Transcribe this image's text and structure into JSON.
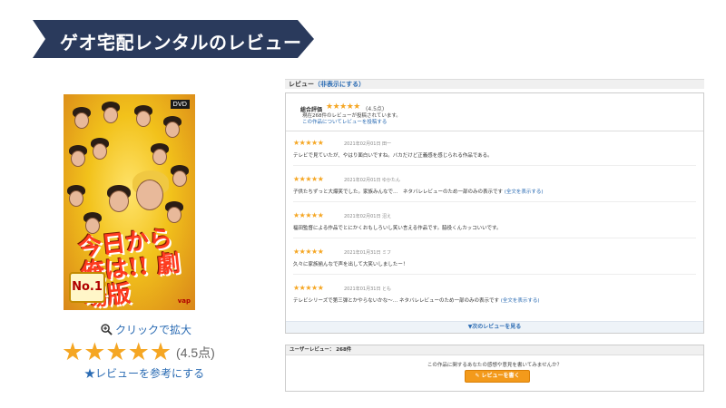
{
  "banner": {
    "title": "ゲオ宅配レンタルのレビュー",
    "color": "#2a3a5c"
  },
  "poster": {
    "dvd_badge": "DVD",
    "title_art": "今日から俺は!! 劇場版",
    "badge": "No.1",
    "label": "vap"
  },
  "zoom": {
    "label": "クリックで拡大",
    "icon": "magnifier-plus-icon"
  },
  "rating": {
    "stars": "★★★★★",
    "score": "(4.5点)",
    "value": 4.5
  },
  "helpful_link": "★レビューを参考にする",
  "reviews_panel": {
    "header": "レビュー",
    "toggle": "（非表示にする）",
    "summary": {
      "label": "総合評価",
      "stars": "★★★★★",
      "score": "(4.5点)",
      "count_text": "現在268件のレビューが投稿されています。",
      "post_link": "この作品についてレビューを投稿する"
    },
    "items": [
      {
        "stars": "★★★★★",
        "meta": "2021年02月01日 田一",
        "body": "テレビで見ていたが、やはり面白いですね。バカだけど正義感を感じられる作品である。",
        "more": ""
      },
      {
        "stars": "★★★★★",
        "meta": "2021年02月01日 ゆかたん",
        "body": "子供たちずっと大爆笑でした。家族みんなで…　ネタバレレビューのため一部のみの表示です",
        "more": "(全文を表示する)"
      },
      {
        "stars": "★★★★★",
        "meta": "2021年02月01日 沼え",
        "body": "福田監督による作品でとにかくおもしろいし笑い言える作品です。脇役くんカッコいいです。",
        "more": ""
      },
      {
        "stars": "★★★★★",
        "meta": "2021年01月31日 ミフ",
        "body": "久々に家族揃んなで声を出して大笑いしましたー！",
        "more": ""
      },
      {
        "stars": "★★★★★",
        "meta": "2021年01月31日 とも",
        "body": "テレビシリーズで第三弾とかやらないかな～… ネタバレレビューのため一部のみの表示です",
        "more": "(全文を表示する)"
      }
    ],
    "next_label": "▼次のレビューを見る"
  },
  "user_reviews": {
    "header": "ユーザーレビュー： 268件",
    "prompt": "この作品に関するあなたの感想や意見を書いてみませんか？",
    "button": "✎ レビューを書く"
  },
  "colors": {
    "star": "#f5a623",
    "link": "#2a6bb3",
    "button": "#f39a1b"
  }
}
